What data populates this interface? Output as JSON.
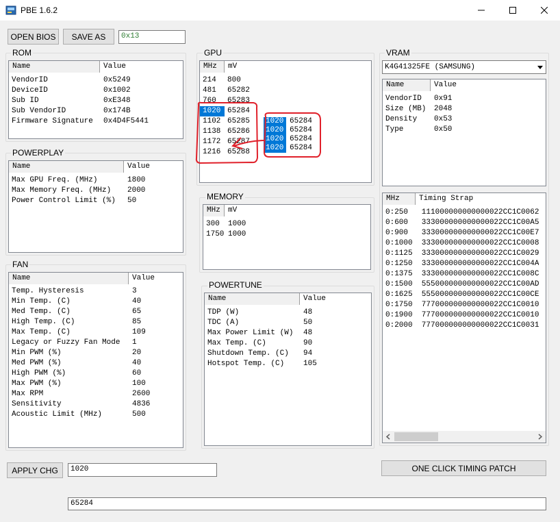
{
  "window": {
    "title": "PBE 1.6.2"
  },
  "toolbar": {
    "open_bios": "OPEN BIOS",
    "save_as": "SAVE AS",
    "offset_value": "0x13"
  },
  "rom": {
    "title": "ROM",
    "columns": [
      "Name",
      "Value"
    ],
    "rows": [
      [
        "VendorID",
        "0x5249"
      ],
      [
        "DeviceID",
        "0x1002"
      ],
      [
        "Sub ID",
        "0xE348"
      ],
      [
        "Sub VendorID",
        "0x174B"
      ],
      [
        "Firmware Signature",
        "0x4D4F5441"
      ]
    ]
  },
  "powerplay": {
    "title": "POWERPLAY",
    "columns": [
      "Name",
      "Value"
    ],
    "rows": [
      [
        "Max GPU Freq. (MHz)",
        "1800"
      ],
      [
        "Max Memory Freq. (MHz)",
        "2000"
      ],
      [
        "Power Control Limit (%)",
        "50"
      ]
    ]
  },
  "fan": {
    "title": "FAN",
    "columns": [
      "Name",
      "Value"
    ],
    "rows": [
      [
        "Temp. Hysteresis",
        "3"
      ],
      [
        "Min Temp. (C)",
        "40"
      ],
      [
        "Med Temp. (C)",
        "65"
      ],
      [
        "High Temp. (C)",
        "85"
      ],
      [
        "Max Temp. (C)",
        "109"
      ],
      [
        "Legacy or Fuzzy Fan Mode",
        "1"
      ],
      [
        "Min PWM (%)",
        "20"
      ],
      [
        "Med PWM (%)",
        "40"
      ],
      [
        "High PWM (%)",
        "60"
      ],
      [
        "Max PWM (%)",
        "100"
      ],
      [
        "Max RPM",
        "2600"
      ],
      [
        "Sensitivity",
        "4836"
      ],
      [
        "Acoustic Limit (MHz)",
        "500"
      ]
    ]
  },
  "gpu": {
    "title": "GPU",
    "columns": [
      "MHz",
      "mV"
    ],
    "rows": [
      [
        "214",
        "800"
      ],
      [
        "481",
        "65282"
      ],
      [
        "760",
        "65283"
      ],
      [
        "1020",
        "65284"
      ],
      [
        "1102",
        "65285"
      ],
      [
        "1138",
        "65286"
      ],
      [
        "1172",
        "65287"
      ],
      [
        "1216",
        "65288"
      ]
    ],
    "annotation_rows": [
      [
        "1020",
        "65284"
      ],
      [
        "1020",
        "65284"
      ],
      [
        "1020",
        "65284"
      ],
      [
        "1020",
        "65284"
      ]
    ],
    "annotation_color": "#e0202a"
  },
  "memory": {
    "title": "MEMORY",
    "columns": [
      "MHz",
      "mV"
    ],
    "rows": [
      [
        "300",
        "1000"
      ],
      [
        "1750",
        "1000"
      ]
    ]
  },
  "powertune": {
    "title": "POWERTUNE",
    "columns": [
      "Name",
      "Value"
    ],
    "rows": [
      [
        "TDP (W)",
        "48"
      ],
      [
        "TDC (A)",
        "50"
      ],
      [
        "Max Power Limit (W)",
        "48"
      ],
      [
        "Max Temp. (C)",
        "90"
      ],
      [
        "Shutdown Temp. (C)",
        "94"
      ],
      [
        "Hotspot Temp. (C)",
        "105"
      ]
    ]
  },
  "vram": {
    "title": "VRAM",
    "selected": "K4G41325FE (SAMSUNG)",
    "columns": [
      "Name",
      "Value"
    ],
    "rows": [
      [
        "VendorID",
        "0x91"
      ],
      [
        "Size (MB)",
        "2048"
      ],
      [
        "Density",
        "0x53"
      ],
      [
        "Type",
        "0x50"
      ]
    ]
  },
  "timing": {
    "columns": [
      "MHz",
      "Timing Strap"
    ],
    "rows": [
      "0:250   111000000000000022CC1C0062",
      "0:600   333000000000000022CC1C00A5",
      "0:900   333000000000000022CC1C00E7",
      "0:1000  333000000000000022CC1C0008",
      "0:1125  333000000000000022CC1C0029",
      "0:1250  333000000000000022CC1C004A",
      "0:1375  333000000000000022CC1C008C",
      "0:1500  555000000000000022CC1C00AD",
      "0:1625  555000000000000022CC1C00CE",
      "0:1750  777000000000000022CC1C0010",
      "0:1900  777000000000000022CC1C0010",
      "0:2000  777000000000000022CC1C0031"
    ]
  },
  "bottom": {
    "apply_label": "APPLY CHG",
    "apply_value": "1020",
    "timing_patch_label": "ONE CLICK TIMING PATCH",
    "status_value": "65284"
  }
}
